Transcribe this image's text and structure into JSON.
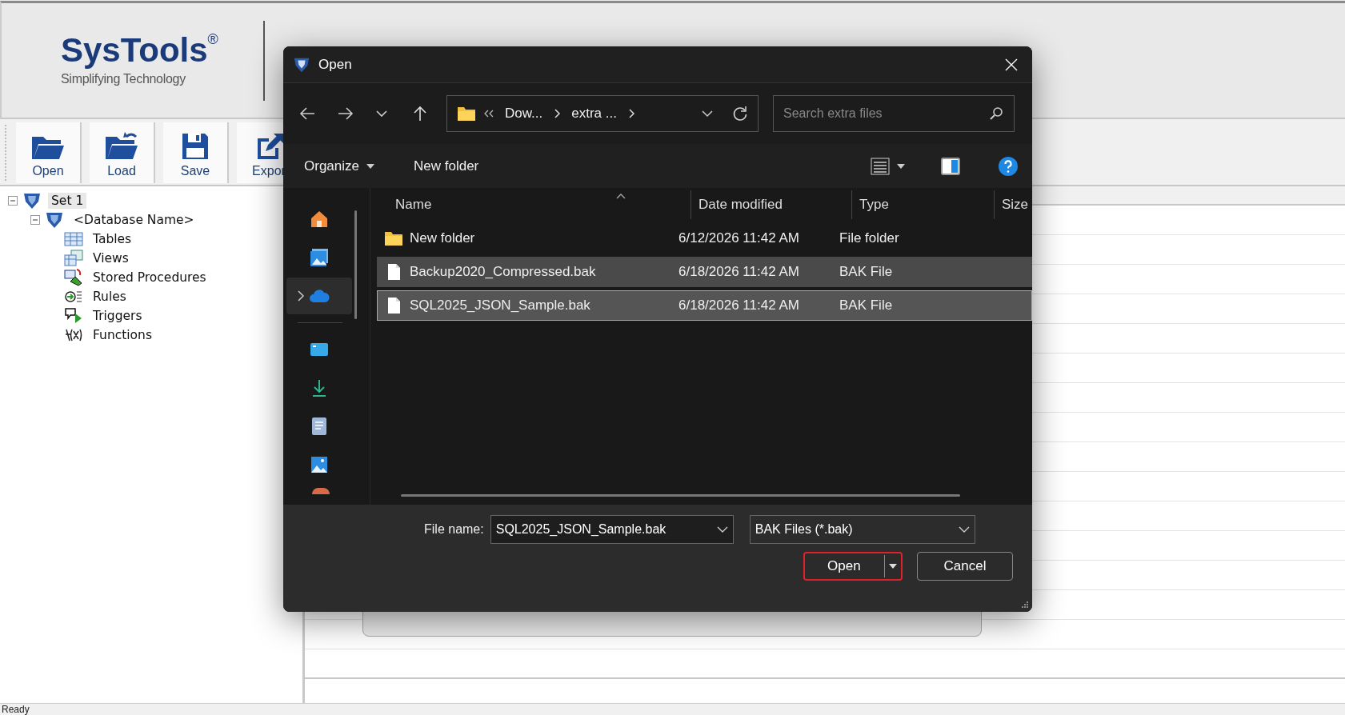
{
  "logo": {
    "name": "SysTools",
    "mark": "®",
    "tagline": "Simplifying Technology"
  },
  "toolbar": [
    {
      "label": "Open",
      "kind": "open"
    },
    {
      "label": "Load",
      "kind": "load"
    },
    {
      "label": "Save",
      "kind": "save"
    },
    {
      "label": "Expor",
      "kind": "export"
    }
  ],
  "tree": {
    "label": "Set 1",
    "kind": "set",
    "selected": true,
    "expanded": true,
    "children": [
      {
        "label": "<Database Name>",
        "kind": "database",
        "selected": false,
        "expanded": true,
        "children": [
          {
            "label": "Tables",
            "kind": "tables",
            "selected": false
          },
          {
            "label": "Views",
            "kind": "views",
            "selected": false
          },
          {
            "label": "Stored Procedures",
            "kind": "procedures",
            "selected": false
          },
          {
            "label": "Rules",
            "kind": "rules",
            "selected": false
          },
          {
            "label": "Triggers",
            "kind": "triggers",
            "selected": false
          },
          {
            "label": "Functions",
            "kind": "functions",
            "selected": false
          }
        ]
      }
    ]
  },
  "dialog": {
    "title": "Open",
    "breadcrumb": [
      "Dow...",
      "extra ..."
    ],
    "search": {
      "placeholder": "Search extra files"
    },
    "commands": {
      "organize": "Organize",
      "new_folder": "New folder"
    },
    "nav": [
      {
        "kind": "home",
        "selected": false
      },
      {
        "kind": "gallery",
        "selected": false
      },
      {
        "kind": "cloud",
        "selected": true
      },
      {
        "kind": "desktop",
        "selected": false
      },
      {
        "kind": "downloads",
        "selected": false
      },
      {
        "kind": "documents",
        "selected": false
      },
      {
        "kind": "pictures",
        "selected": false
      }
    ],
    "columns": [
      "Name",
      "Date modified",
      "Type",
      "Size"
    ],
    "rows": [
      {
        "name": "New folder",
        "date": "6/12/2026 11:42 AM",
        "type": "File folder",
        "kind": "folder",
        "selected": false
      },
      {
        "name": "Backup2020_Compressed.bak",
        "date": "6/18/2026 11:42 AM",
        "type": "BAK File",
        "kind": "file",
        "selected": true
      },
      {
        "name": "SQL2025_JSON_Sample.bak",
        "date": "6/18/2026 11:42 AM",
        "type": "BAK File",
        "kind": "file",
        "selected": true
      }
    ],
    "file_name": {
      "label": "File name:",
      "value": "SQL2025_JSON_Sample.bak"
    },
    "filter": {
      "value": "BAK Files (*.bak)"
    },
    "buttons": [
      {
        "label": "Open",
        "kind": "primary"
      },
      {
        "label": "Cancel",
        "kind": "secondary"
      }
    ]
  },
  "status_bar": {
    "text": "Ready"
  }
}
